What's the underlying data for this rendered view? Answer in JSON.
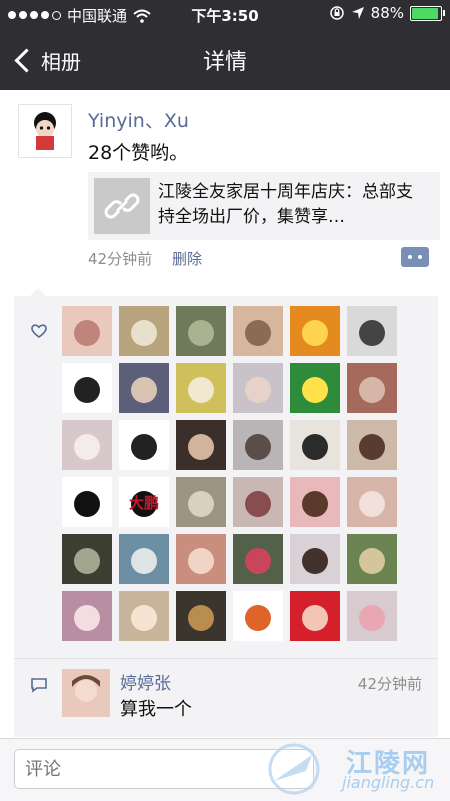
{
  "status_bar": {
    "carrier": "中国联通",
    "time": "下午3:50",
    "battery_text": "88%",
    "battery_level": 0.88
  },
  "nav": {
    "back_label": "相册",
    "title": "详情"
  },
  "post": {
    "author": "Yinyin、Xu",
    "text": "28个赞哟。",
    "link_title": "江陵全友家居十周年店庆：总部支持全场出厂价，集赞享…",
    "time": "42分钟前",
    "delete_label": "删除"
  },
  "likes": {
    "avatars": [
      {
        "bg": "#e8c9bc",
        "fg": "#c0847a",
        "label": ""
      },
      {
        "bg": "#b7a47c",
        "fg": "#e7e0cc",
        "label": ""
      },
      {
        "bg": "#6f7a5a",
        "fg": "#a9b392",
        "label": ""
      },
      {
        "bg": "#d7b69e",
        "fg": "#8c6b54",
        "label": ""
      },
      {
        "bg": "#e58a1f",
        "fg": "#ffd34d",
        "label": ""
      },
      {
        "bg": "#d9d9d9",
        "fg": "#444444",
        "label": ""
      },
      {
        "bg": "#ffffff",
        "fg": "#222222",
        "label": ""
      },
      {
        "bg": "#5b5f7a",
        "fg": "#d8c2b2",
        "label": ""
      },
      {
        "bg": "#cfc05c",
        "fg": "#f2e7cf",
        "label": ""
      },
      {
        "bg": "#c9c2c9",
        "fg": "#e6d2c8",
        "label": ""
      },
      {
        "bg": "#2e8b3a",
        "fg": "#ffe24a",
        "label": ""
      },
      {
        "bg": "#a56a5c",
        "fg": "#d6b6a6",
        "label": ""
      },
      {
        "bg": "#d8c7cb",
        "fg": "#f3ece8",
        "label": ""
      },
      {
        "bg": "#ffffff",
        "fg": "#222222",
        "label": ""
      },
      {
        "bg": "#3a3029",
        "fg": "#d2b49c",
        "label": ""
      },
      {
        "bg": "#b9b5b6",
        "fg": "#5a4e4b",
        "label": ""
      },
      {
        "bg": "#e9e3dd",
        "fg": "#2b2b2b",
        "label": ""
      },
      {
        "bg": "#cdb9a8",
        "fg": "#5a3b30",
        "label": ""
      },
      {
        "bg": "#ffffff",
        "fg": "#111111",
        "label": ""
      },
      {
        "bg": "#ffffff",
        "fg": "#111111",
        "label": "大鹏"
      },
      {
        "bg": "#9c9582",
        "fg": "#d9d1bd",
        "label": ""
      },
      {
        "bg": "#c9b7b3",
        "fg": "#8a4d4f",
        "label": ""
      },
      {
        "bg": "#e8b8bb",
        "fg": "#5a3a2a",
        "label": ""
      },
      {
        "bg": "#d6b4a8",
        "fg": "#f1e0d9",
        "label": ""
      },
      {
        "bg": "#3a3f32",
        "fg": "#a3a58e",
        "label": ""
      },
      {
        "bg": "#6d8fa3",
        "fg": "#dfe5e6",
        "label": ""
      },
      {
        "bg": "#c98e7d",
        "fg": "#f0d4c6",
        "label": ""
      },
      {
        "bg": "#54614a",
        "fg": "#c7465a",
        "label": ""
      },
      {
        "bg": "#d8d2d6",
        "fg": "#42312d",
        "label": ""
      },
      {
        "bg": "#6b8452",
        "fg": "#d4c59a",
        "label": ""
      },
      {
        "bg": "#b98ea2",
        "fg": "#f2dde3",
        "label": ""
      },
      {
        "bg": "#c7b49a",
        "fg": "#f5e4d2",
        "label": ""
      },
      {
        "bg": "#3b352e",
        "fg": "#b88d4d",
        "label": ""
      },
      {
        "bg": "#ffffff",
        "fg": "#e0632a",
        "label": ""
      },
      {
        "bg": "#d51f2a",
        "fg": "#f3c5b4",
        "label": ""
      },
      {
        "bg": "#d8cbd0",
        "fg": "#e9a7b1",
        "label": ""
      }
    ]
  },
  "comment": {
    "name": "婷婷张",
    "time": "42分钟前",
    "text": "算我一个"
  },
  "input": {
    "placeholder": "评论"
  },
  "watermark": {
    "title": "江陵网",
    "site": "jiangling.cn"
  }
}
